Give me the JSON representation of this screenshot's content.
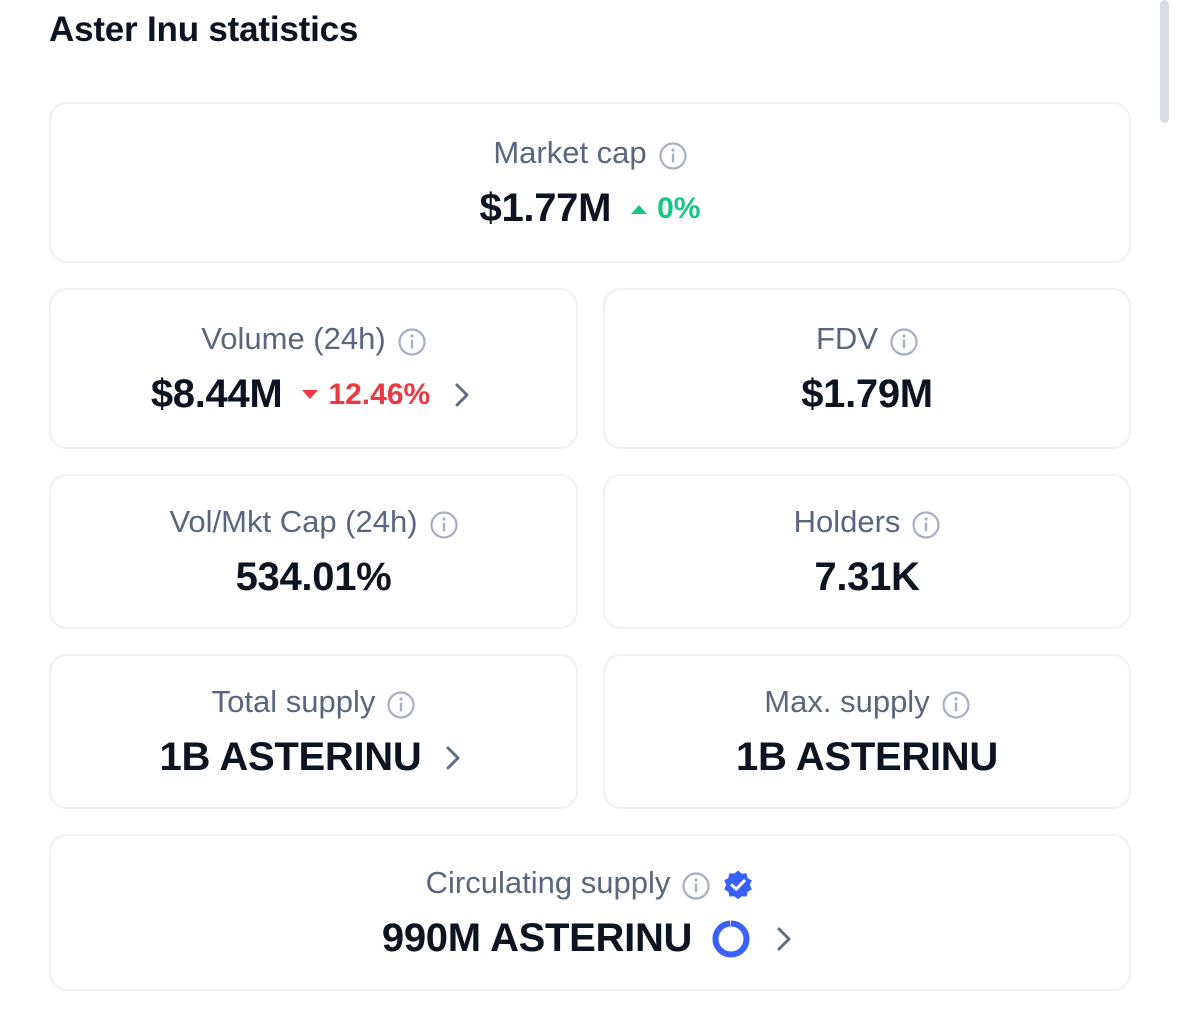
{
  "title": "Aster Inu statistics",
  "colors": {
    "positive": "#16c784",
    "negative": "#ea3943",
    "label": "#58667e",
    "value": "#0d1421",
    "verified": "#3861fb"
  },
  "stats": {
    "market_cap": {
      "label": "Market cap",
      "value": "$1.77M",
      "change": "0%",
      "direction": "up"
    },
    "volume": {
      "label": "Volume (24h)",
      "value": "$8.44M",
      "change": "12.46%",
      "direction": "down"
    },
    "fdv": {
      "label": "FDV",
      "value": "$1.79M"
    },
    "vol_mkt_cap": {
      "label": "Vol/Mkt Cap (24h)",
      "value": "534.01%"
    },
    "holders": {
      "label": "Holders",
      "value": "7.31K"
    },
    "total_supply": {
      "label": "Total supply",
      "value": "1B ASTERINU"
    },
    "max_supply": {
      "label": "Max. supply",
      "value": "1B ASTERINU"
    },
    "circulating_supply": {
      "label": "Circulating supply",
      "value": "990M ASTERINU",
      "ratio": 0.99
    }
  },
  "icons": {
    "info": "info-icon",
    "chevron": "chevron-right-icon",
    "verified": "verified-badge-icon",
    "ring": "supply-progress-ring",
    "up": "caret-up-icon",
    "down": "caret-down-icon"
  }
}
